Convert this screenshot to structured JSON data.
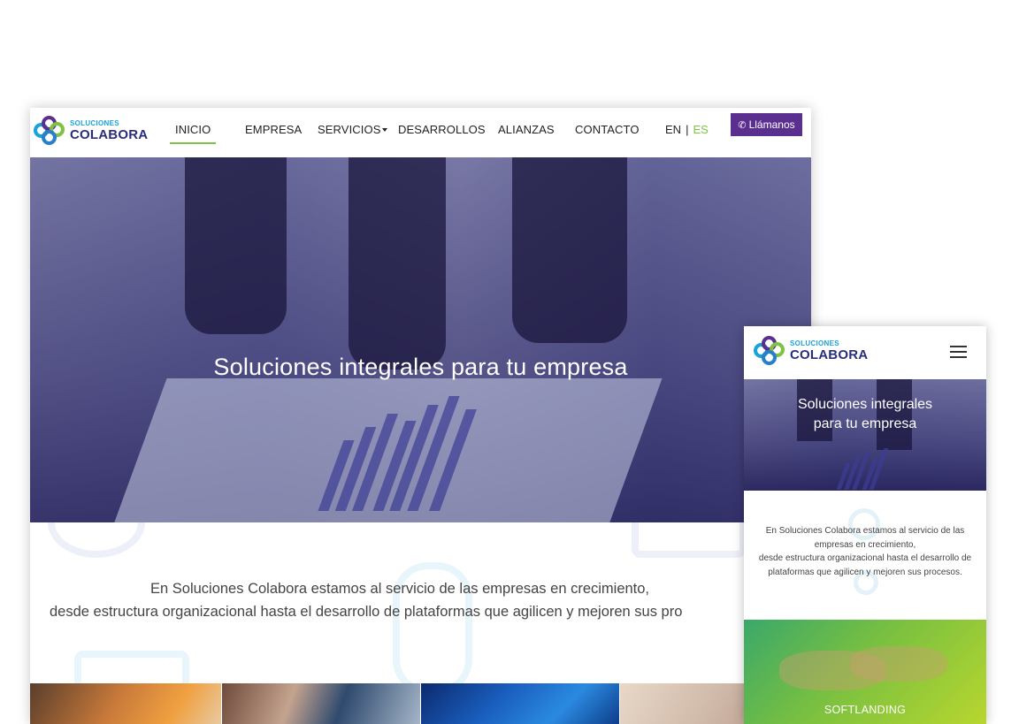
{
  "brand": {
    "small": "SOLUCIONES",
    "big": "COLABORA",
    "colors": {
      "navy": "#2a2d7c",
      "cyan": "#1aa3d9",
      "green": "#7dc242",
      "purple": "#5b2f8f"
    }
  },
  "desktop": {
    "nav": {
      "items": [
        {
          "label": "INICIO",
          "active": true
        },
        {
          "label": "EMPRESA"
        },
        {
          "label": "SERVICIOS",
          "has_dropdown": true
        },
        {
          "label": "DESARROLLOS"
        },
        {
          "label": "ALIANZAS"
        },
        {
          "label": "CONTACTO"
        }
      ],
      "lang": {
        "en": "EN",
        "separator": "|",
        "es": "ES",
        "active": "ES"
      },
      "call": {
        "label": "Llámanos",
        "icon": "phone-icon"
      }
    },
    "hero": {
      "title": "Soluciones integrales para tu empresa"
    },
    "intro": {
      "line1": "En Soluciones Colabora estamos al servicio de las empresas en crecimiento,",
      "line2": "desde estructura organizacional hasta el desarrollo de plataformas que agilicen y mejoren sus pro"
    }
  },
  "mobile": {
    "menu_icon": "hamburger-icon",
    "hero": {
      "title_line1": "Soluciones integrales",
      "title_line2": "para tu empresa"
    },
    "intro": {
      "line1": "En Soluciones Colabora estamos al servicio de las",
      "line2": "empresas en crecimiento,",
      "line3": "desde estructura organizacional hasta el desarrollo de",
      "line4": "plataformas que agilicen y mejoren sus procesos."
    },
    "tile": {
      "label": "SOFTLANDING"
    }
  }
}
